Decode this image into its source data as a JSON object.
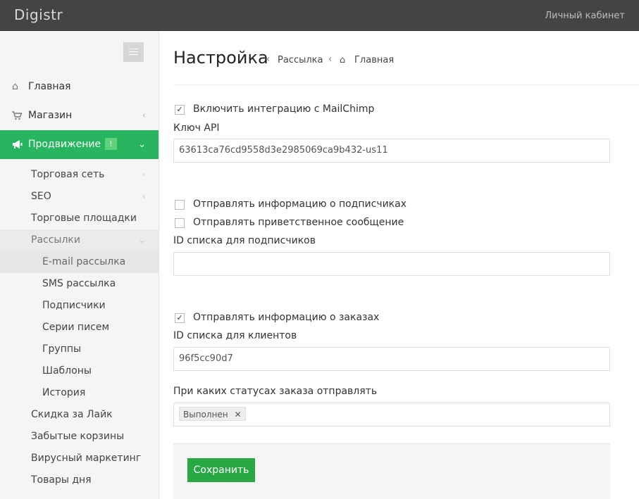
{
  "app": {
    "brand": "Digistr",
    "user_link": "Личный кабинет"
  },
  "sidebar": {
    "items": [
      {
        "icon": "home-icon",
        "label": "Главная"
      },
      {
        "icon": "cart-icon",
        "label": "Магазин"
      },
      {
        "icon": "bullhorn-icon",
        "label": "Продвижение",
        "badge": "!"
      }
    ],
    "subitems": [
      {
        "label": "Торговая сеть"
      },
      {
        "label": "SEO"
      },
      {
        "label": "Торговые площадки"
      },
      {
        "label": "Рассылки"
      }
    ],
    "mail_items": [
      {
        "label": "E-mail рассылка"
      },
      {
        "label": "SMS рассылка"
      },
      {
        "label": "Подписчики"
      },
      {
        "label": "Серии писем"
      },
      {
        "label": "Группы"
      },
      {
        "label": "Шаблоны"
      },
      {
        "label": "История"
      }
    ],
    "bottom_items": [
      {
        "label": "Скидка за Лайк"
      },
      {
        "label": "Забытые корзины"
      },
      {
        "label": "Вирусный маркетинг"
      },
      {
        "label": "Товары дня"
      }
    ]
  },
  "header": {
    "title": "Настройка",
    "breadcrumb": [
      "Рассылка",
      "Главная"
    ]
  },
  "form": {
    "enable_label": "Включить интеграцию с MailChimp",
    "enable_checked": true,
    "api_key_label": "Ключ API",
    "api_key_value": "63613ca76cd9558d3e2985069ca9b432-us11",
    "send_subscribers_label": "Отправлять информацию о подписчиках",
    "send_subscribers_checked": false,
    "send_welcome_label": "Отправлять приветственное сообщение",
    "send_welcome_checked": false,
    "subscribers_list_label": "ID списка для подписчиков",
    "subscribers_list_value": "",
    "send_orders_label": "Отправлять информацию о заказах",
    "send_orders_checked": true,
    "clients_list_label": "ID списка для клиентов",
    "clients_list_value": "96f5cc90d7",
    "statuses_label": "При каких статусах заказа отправлять",
    "statuses": [
      "Выполнен"
    ],
    "check_mark": "✓",
    "tag_remove": "✕"
  },
  "footer": {
    "save_label": "Сохранить"
  },
  "colors": {
    "accent": "#27b55f",
    "button": "#27a844",
    "topbar": "#444444"
  }
}
